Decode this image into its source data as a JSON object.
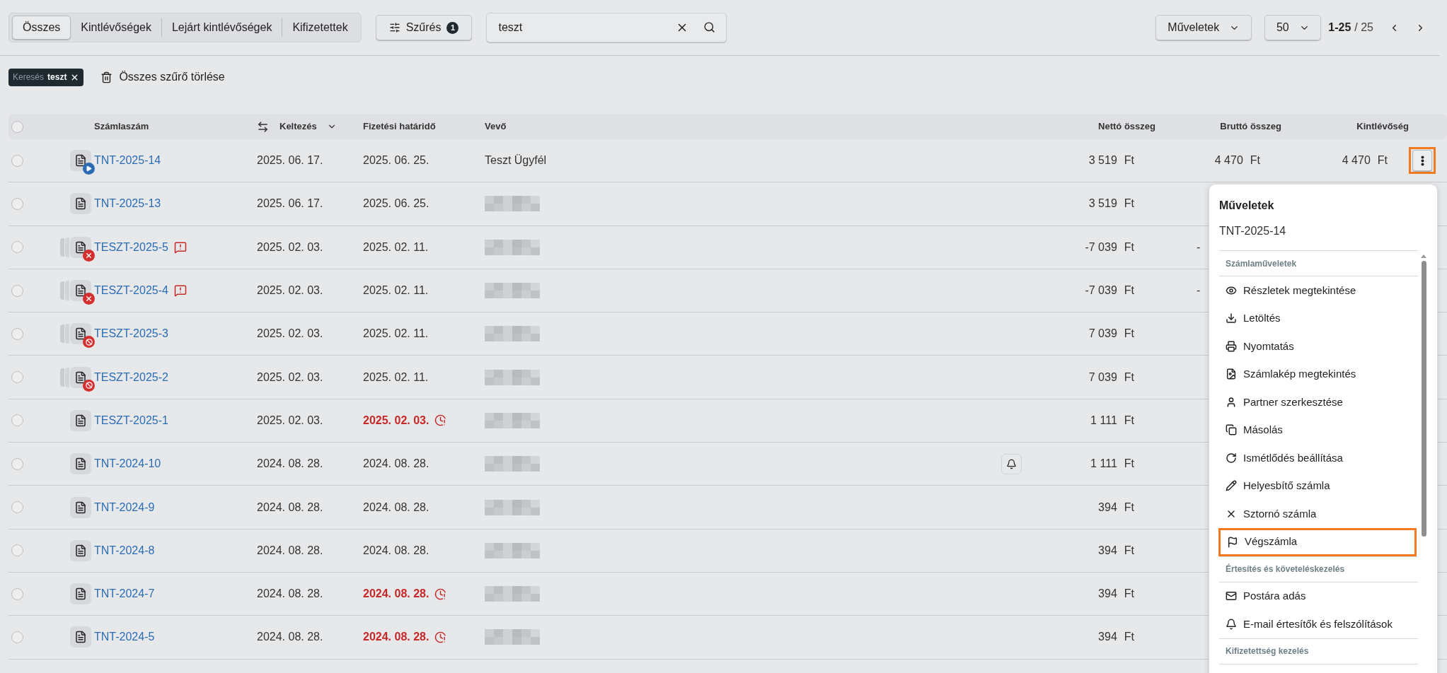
{
  "tabs": [
    {
      "label": "Összes",
      "selected": true
    },
    {
      "label": "Kintlévőségek",
      "selected": false
    },
    {
      "label": "Lejárt kintlévőségek",
      "selected": false
    },
    {
      "label": "Kifizetettek",
      "selected": false
    }
  ],
  "filter_button": {
    "label": "Szűrés",
    "count": "1"
  },
  "search": {
    "value": "teszt"
  },
  "actions_button": {
    "label": "Műveletek"
  },
  "page_size": {
    "value": "50"
  },
  "pagination": {
    "range": "1-25",
    "total": "/ 25"
  },
  "chips": [
    {
      "label": "Keresés",
      "value": "teszt"
    }
  ],
  "clear_filters": {
    "label": "Összes szűrő törlése"
  },
  "table": {
    "all_checked": false,
    "columns": [
      "Számlaszám",
      "Keltezés",
      "Fizetési határidő",
      "Vevő",
      "Nettó összeg",
      "Bruttó összeg",
      "Kintlévőség"
    ],
    "rows": [
      {
        "checked": false,
        "kind": "sent",
        "number": "TNT-2025-14",
        "warning": false,
        "issued": "2025. 06. 17.",
        "due": "2025. 06. 25.",
        "overdue": false,
        "customer": {
          "kind": "text",
          "text": "Teszt Ügyfél"
        },
        "reminder": false,
        "net": {
          "amount": "3 519",
          "currency": "Ft"
        },
        "gross": {
          "amount": "4 470",
          "currency": "Ft",
          "cut": false
        },
        "outstanding": {
          "amount": "4 470",
          "currency": "Ft",
          "cut": false
        },
        "menu_open": true
      },
      {
        "checked": false,
        "kind": "plain",
        "number": "TNT-2025-13",
        "warning": false,
        "issued": "2025. 06. 17.",
        "due": "2025. 06. 25.",
        "overdue": false,
        "customer": {
          "kind": "redacted"
        },
        "reminder": false,
        "net": {
          "amount": "3 519",
          "currency": "Ft"
        },
        "menu_open": false
      },
      {
        "checked": false,
        "kind": "cancelled",
        "number": "TESZT-2025-5",
        "warning": true,
        "issued": "2025. 02. 03.",
        "due": "2025. 02. 11.",
        "overdue": false,
        "customer": {
          "kind": "redacted"
        },
        "reminder": false,
        "net": {
          "amount": "-7 039",
          "currency": "Ft"
        },
        "gross": {
          "amount": "-",
          "cut": true
        },
        "menu_open": false
      },
      {
        "checked": false,
        "kind": "cancelled",
        "number": "TESZT-2025-4",
        "warning": true,
        "issued": "2025. 02. 03.",
        "due": "2025. 02. 11.",
        "overdue": false,
        "customer": {
          "kind": "redacted"
        },
        "reminder": false,
        "net": {
          "amount": "-7 039",
          "currency": "Ft"
        },
        "gross": {
          "amount": "-",
          "cut": true
        },
        "menu_open": false
      },
      {
        "checked": false,
        "kind": "blocked",
        "number": "TESZT-2025-3",
        "warning": false,
        "issued": "2025. 02. 03.",
        "due": "2025. 02. 11.",
        "overdue": false,
        "customer": {
          "kind": "redacted"
        },
        "reminder": false,
        "net": {
          "amount": "7 039",
          "currency": "Ft"
        },
        "menu_open": false
      },
      {
        "checked": false,
        "kind": "blocked",
        "number": "TESZT-2025-2",
        "warning": false,
        "issued": "2025. 02. 03.",
        "due": "2025. 02. 11.",
        "overdue": false,
        "customer": {
          "kind": "redacted"
        },
        "reminder": false,
        "net": {
          "amount": "7 039",
          "currency": "Ft"
        },
        "menu_open": false
      },
      {
        "checked": false,
        "kind": "plain",
        "number": "TESZT-2025-1",
        "warning": false,
        "issued": "2025. 02. 03.",
        "due": "2025. 02. 03.",
        "overdue": true,
        "customer": {
          "kind": "redacted"
        },
        "reminder": false,
        "net": {
          "amount": "1 111",
          "currency": "Ft"
        },
        "menu_open": false
      },
      {
        "checked": false,
        "kind": "plain",
        "number": "TNT-2024-10",
        "warning": false,
        "issued": "2024. 08. 28.",
        "due": "2024. 08. 28.",
        "overdue": false,
        "customer": {
          "kind": "redacted"
        },
        "reminder": true,
        "net": {
          "amount": "1 111",
          "currency": "Ft"
        },
        "menu_open": false
      },
      {
        "checked": false,
        "kind": "plain",
        "number": "TNT-2024-9",
        "warning": false,
        "issued": "2024. 08. 28.",
        "due": "2024. 08. 28.",
        "overdue": false,
        "customer": {
          "kind": "redacted"
        },
        "reminder": false,
        "net": {
          "amount": "394",
          "currency": "Ft"
        },
        "menu_open": false
      },
      {
        "checked": false,
        "kind": "plain",
        "number": "TNT-2024-8",
        "warning": false,
        "issued": "2024. 08. 28.",
        "due": "2024. 08. 28.",
        "overdue": false,
        "customer": {
          "kind": "redacted"
        },
        "reminder": false,
        "net": {
          "amount": "394",
          "currency": "Ft"
        },
        "menu_open": false
      },
      {
        "checked": false,
        "kind": "plain",
        "number": "TNT-2024-7",
        "warning": false,
        "issued": "2024. 08. 28.",
        "due": "2024. 08. 28.",
        "overdue": true,
        "customer": {
          "kind": "redacted"
        },
        "reminder": false,
        "net": {
          "amount": "394",
          "currency": "Ft"
        },
        "menu_open": false
      },
      {
        "checked": false,
        "kind": "plain",
        "number": "TNT-2024-5",
        "warning": false,
        "issued": "2024. 08. 28.",
        "due": "2024. 08. 28.",
        "overdue": true,
        "customer": {
          "kind": "redacted"
        },
        "reminder": false,
        "net": {
          "amount": "394",
          "currency": "Ft"
        },
        "menu_open": false
      }
    ]
  },
  "menu": {
    "title": "Műveletek",
    "subtitle": "TNT-2025-14",
    "sections": [
      {
        "label": "Számlaműveletek",
        "items": [
          {
            "kind": "eye",
            "label": "Részletek megtekintése",
            "highlighted": false
          },
          {
            "kind": "download",
            "label": "Letöltés",
            "highlighted": false
          },
          {
            "kind": "printer",
            "label": "Nyomtatás",
            "highlighted": false
          },
          {
            "kind": "file-image",
            "label": "Számlakép megtekintés",
            "highlighted": false
          },
          {
            "kind": "user",
            "label": "Partner szerkesztése",
            "highlighted": false
          },
          {
            "kind": "copy",
            "label": "Másolás",
            "highlighted": false
          },
          {
            "kind": "repeat",
            "label": "Ismétlődés beállítása",
            "highlighted": false
          },
          {
            "kind": "pencil",
            "label": "Helyesbítő számla",
            "highlighted": false
          },
          {
            "kind": "x",
            "label": "Sztornó számla",
            "highlighted": false
          },
          {
            "kind": "flag",
            "label": "Végszámla",
            "highlighted": true
          }
        ]
      },
      {
        "label": "Értesítés és követeléskezelés",
        "items": [
          {
            "kind": "mail",
            "label": "Postára adás",
            "highlighted": false
          },
          {
            "kind": "bell",
            "label": "E-mail értesítők és felszólítások",
            "highlighted": false
          }
        ]
      },
      {
        "label": "Kifizetettség kezelés"
      }
    ]
  }
}
